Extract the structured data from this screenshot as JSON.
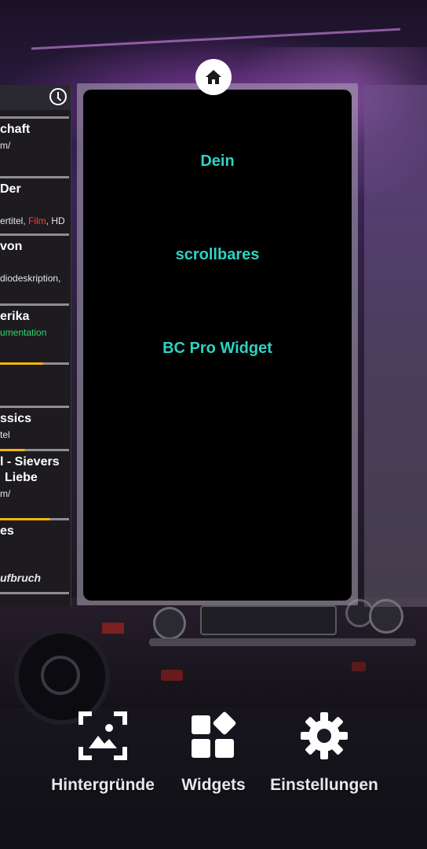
{
  "left_preview": {
    "entries": [
      {
        "title": "chaft",
        "sub": "m/"
      },
      {
        "title": "Der",
        "sub_parts": [
          "ertitel, ",
          "Film",
          ", HD"
        ]
      },
      {
        "title": "von",
        "sub": "diodeskription,"
      },
      {
        "title": "erika",
        "sub": "umentation"
      },
      {
        "title": "ssics",
        "sub": "tel"
      },
      {
        "title_line1": "l - Sievers",
        "title_line2": "Liebe",
        "sub": "m/"
      },
      {
        "title": "es",
        "sub": "ufbruch"
      }
    ]
  },
  "widget": {
    "lines": [
      "Dein",
      "scrollbares",
      "BC Pro Widget"
    ],
    "text_color": "#2fd1c3"
  },
  "actions": [
    {
      "label": "Hintergründe",
      "icon": "wallpaper-icon"
    },
    {
      "label": "Widgets",
      "icon": "widgets-icon"
    },
    {
      "label": "Einstellungen",
      "icon": "gear-icon"
    }
  ],
  "colors": {
    "accent_yellow": "#f2b70f",
    "accent_red": "#ff3b3b",
    "accent_green": "#2fd36a"
  }
}
